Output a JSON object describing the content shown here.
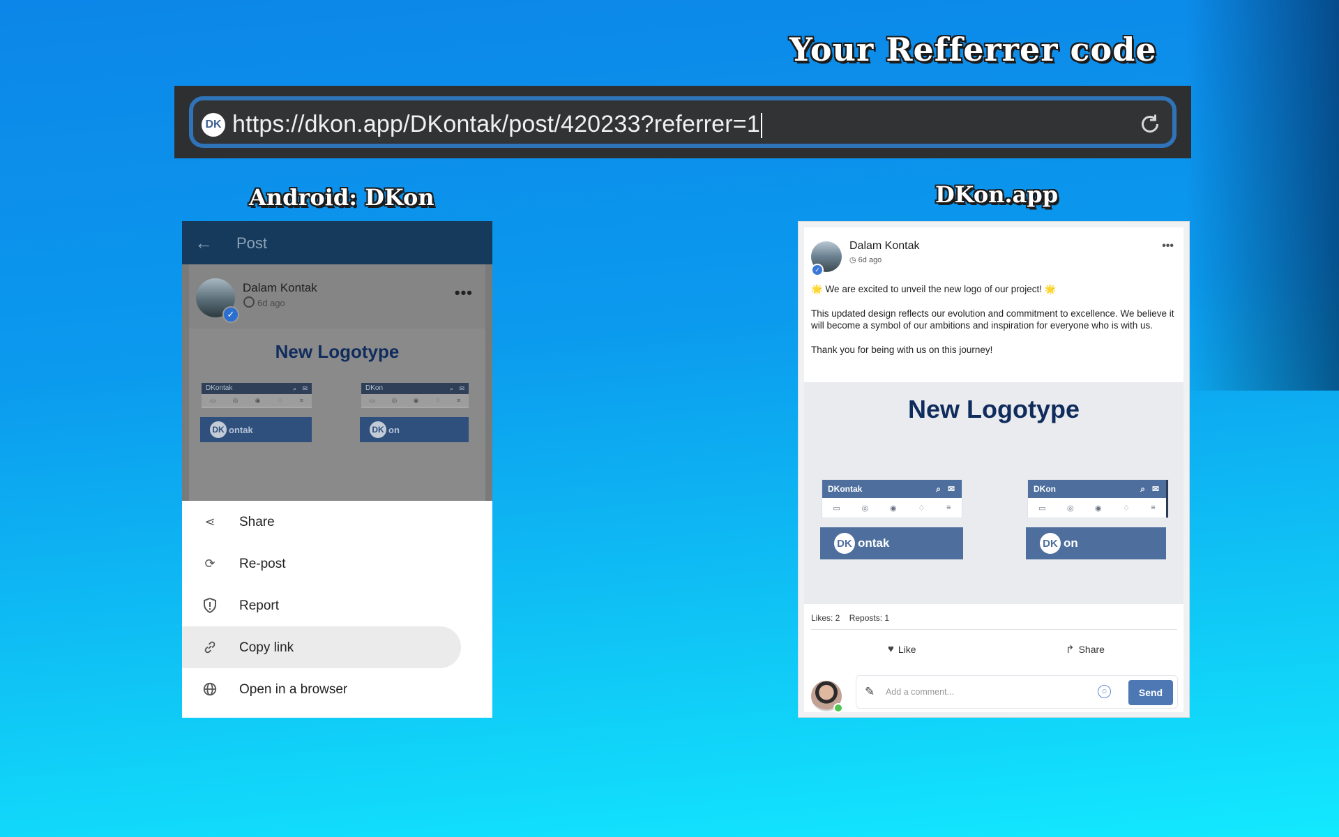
{
  "headings": {
    "main": "Your Refferrer code",
    "android": "Android: DKon",
    "web": "DKon.app"
  },
  "urlbar": {
    "logo_text": "DK",
    "url": "https://dkon.app/DKontak/post/420233?referrer=1"
  },
  "android": {
    "appbar_title": "Post",
    "back_icon": "arrow-left-icon",
    "author": "Dalam Kontak",
    "time": "6d ago",
    "post_title": "New Logotype",
    "logos": [
      {
        "bar_label": "DKontak",
        "brand_suffix": "ontak"
      },
      {
        "bar_label": "DKon",
        "brand_suffix": "on"
      }
    ],
    "brand_badge": "DK",
    "menu": [
      {
        "label": "Share",
        "icon": "share-icon",
        "glyph": "⋖"
      },
      {
        "label": "Re-post",
        "icon": "repost-icon",
        "glyph": "⟳"
      },
      {
        "label": "Report",
        "icon": "report-shield-icon",
        "glyph": "!"
      },
      {
        "label": "Copy link",
        "icon": "link-icon",
        "glyph": "🔗"
      },
      {
        "label": "Open in a browser",
        "icon": "globe-icon",
        "glyph": "◍"
      }
    ]
  },
  "web": {
    "author": "Dalam Kontak",
    "time": "6d ago",
    "paragraphs": [
      "🌟 We are excited to unveil the new logo of our project! 🌟",
      "This updated design reflects our evolution and commitment to excellence. We believe it will become a symbol of our ambitions and inspiration for everyone who is with us.",
      "Thank you for being with us on this journey!"
    ],
    "post_title": "New Logotype",
    "logos": [
      {
        "bar_label": "DKontak",
        "brand_suffix": "ontak"
      },
      {
        "bar_label": "DKon",
        "brand_suffix": "on"
      }
    ],
    "brand_badge": "DK",
    "likes": "Likes: 2",
    "reposts": "Reposts: 1",
    "like_label": "Like",
    "share_label": "Share",
    "comment_placeholder": "Add a comment...",
    "send_label": "Send"
  },
  "colors": {
    "accent": "#4e78b4",
    "android_appbar": "#163a5c",
    "url_border": "#2f74b8"
  }
}
